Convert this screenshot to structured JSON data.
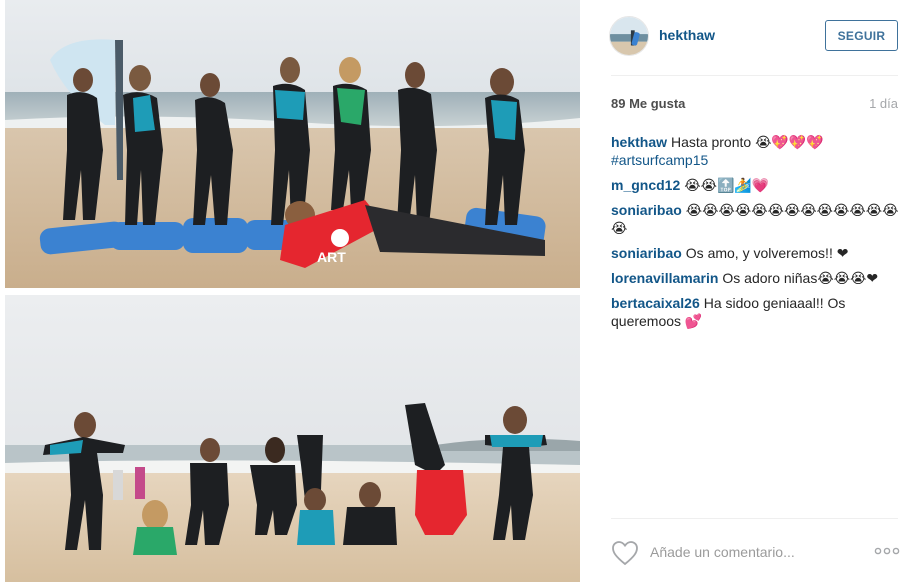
{
  "post": {
    "username": "hekthaw",
    "follow_label": "SEGUIR",
    "likes": "89 Me gusta",
    "time": "1 día"
  },
  "comments": [
    {
      "author": "hekthaw",
      "text": "Hasta pronto 😭💖💖💖",
      "hashtag": "#artsurfcamp15"
    },
    {
      "author": "m_gncd12",
      "text": "😭😭🔝🏄💗"
    },
    {
      "author": "soniaribao",
      "text": "😭😭😭😭😭😭😭😭😭😭😭😭😭😭"
    },
    {
      "author": "soniaribao",
      "text": "Os amo, y volveremos!! ❤"
    },
    {
      "author": "lorenavillamarin",
      "text": "Os adoro niñas😭😭😭❤"
    },
    {
      "author": "bertacaixal26",
      "text": "Ha sidoo geniaaal!! Os queremoos 💕"
    }
  ],
  "footer": {
    "comment_placeholder": "Añade un comentario..."
  },
  "photos": {
    "top_logo": "ART"
  },
  "colors": {
    "link": "#125688",
    "button": "#3f729b",
    "red_shirt": "#e5262f",
    "teal_accent": "#1e9cb7",
    "board_blue": "#3b82d1"
  }
}
